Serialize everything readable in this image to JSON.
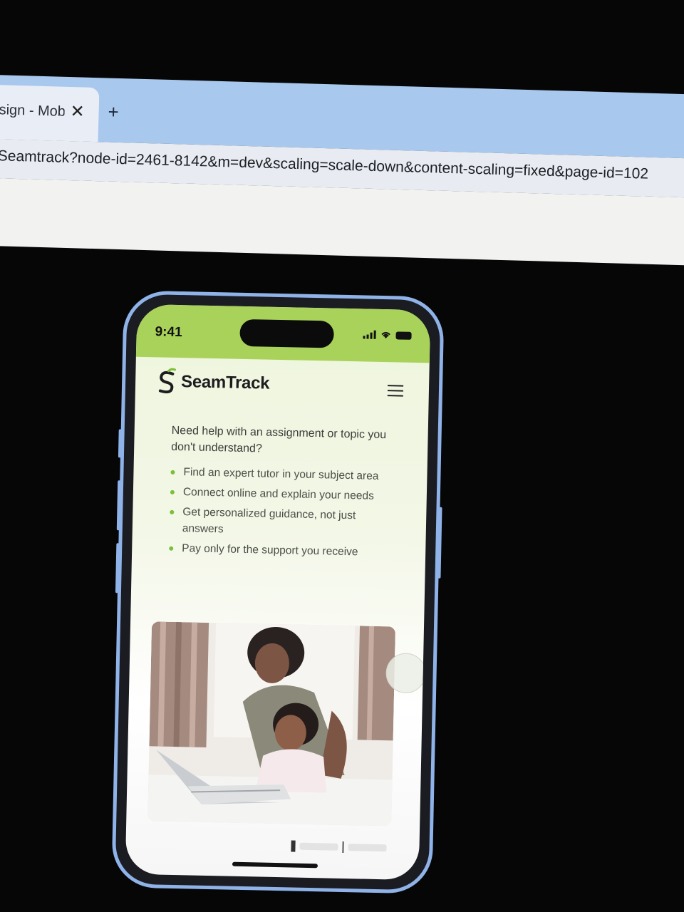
{
  "browser": {
    "tab_title": "sign - Mob",
    "tab_close": "✕",
    "new_tab": "+",
    "url": "Seamtrack?node-id=2461-8142&m=dev&scaling=scale-down&content-scaling=fixed&page-id=102"
  },
  "phone": {
    "status_time": "9:41",
    "brand": "SeamTrack",
    "intro": "Need help with an assignment or topic you don't understand?",
    "bullets": [
      "Find an expert tutor in your subject area",
      "Connect online and explain your needs",
      "Get personalized guidance, not just answers",
      "Pay only for the support you receive"
    ],
    "icons": {
      "logo": "seamtrack-logo-icon",
      "menu": "hamburger-menu-icon",
      "signal": "signal-icon",
      "wifi": "wifi-icon",
      "battery": "battery-icon",
      "bullet": "bullet-dot-icon"
    },
    "colors": {
      "accent": "#a9d25a",
      "bullet": "#7cbf3a",
      "frame": "#8fb3e8"
    }
  }
}
